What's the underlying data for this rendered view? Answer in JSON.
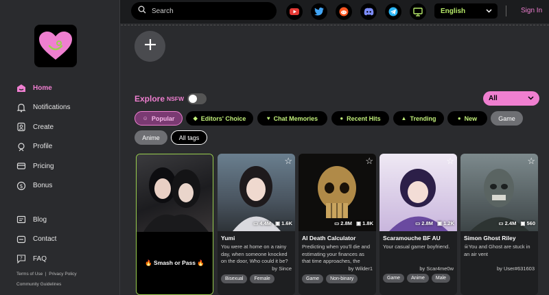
{
  "topbar": {
    "search_placeholder": "Search",
    "social": [
      "youtube-icon",
      "twitter-icon",
      "reddit-icon",
      "discord-icon",
      "telegram-icon",
      "desktop-icon"
    ],
    "language": "English",
    "signin": "Sign In"
  },
  "sidebar": {
    "items": [
      {
        "label": "Home",
        "icon": "home-icon"
      },
      {
        "label": "Notifications",
        "icon": "bell-icon"
      },
      {
        "label": "Create",
        "icon": "create-icon"
      },
      {
        "label": "Profile",
        "icon": "profile-icon"
      },
      {
        "label": "Pricing",
        "icon": "card-icon"
      },
      {
        "label": "Bonus",
        "icon": "dollar-icon"
      }
    ],
    "items2": [
      {
        "label": "Blog",
        "icon": "blog-icon"
      },
      {
        "label": "Contact",
        "icon": "contact-icon"
      },
      {
        "label": "FAQ",
        "icon": "faq-icon"
      }
    ],
    "terms": "Terms of Use",
    "privacy": "Privacy Policy",
    "guidelines": "Community Guidelines"
  },
  "explore": {
    "title": "Explore",
    "nsfw": "NSFW",
    "filter": "All",
    "chips": [
      "Popular",
      "Editors' Choice",
      "Chat Memories",
      "Recent Hits",
      "Trending",
      "New",
      "Game",
      "Anime",
      "All tags"
    ]
  },
  "colors": {
    "accent": "#ef7fd0",
    "lime": "#c2f07a",
    "bg": "#2a2b2e"
  },
  "cards": [
    {
      "name": "",
      "label": "🔥 Smash or Pass 🔥",
      "desc": "",
      "by": "",
      "chats": "",
      "saves": "",
      "tags": []
    },
    {
      "name": "Yumi",
      "desc": "You were at home on a rainy day, when someone knocked on the door, Who could it be?",
      "by": "by Since",
      "chats": "4.4M",
      "saves": "1.6K",
      "tags": [
        "Bisexual",
        "Female"
      ]
    },
    {
      "name": "AI Death Calculator",
      "desc": "Predicting when you'll die and estimating your finances as that time approaches, the",
      "by": "by Wilder1",
      "chats": "2.8M",
      "saves": "1.8K",
      "tags": [
        "Game",
        "Non-binary"
      ]
    },
    {
      "name": "Scaramouche BF AU",
      "desc": "Your casual gamer boyfriend.",
      "by": "by Scar4me0w",
      "chats": "2.8M",
      "saves": "1.2K",
      "tags": [
        "Game",
        "Anime",
        "Male"
      ]
    },
    {
      "name": "Simon Ghost Riley",
      "desc": "☠You and Ghost are stuck in an air vent",
      "by": "by User#631603",
      "chats": "2.4M",
      "saves": "560",
      "tags": []
    }
  ]
}
